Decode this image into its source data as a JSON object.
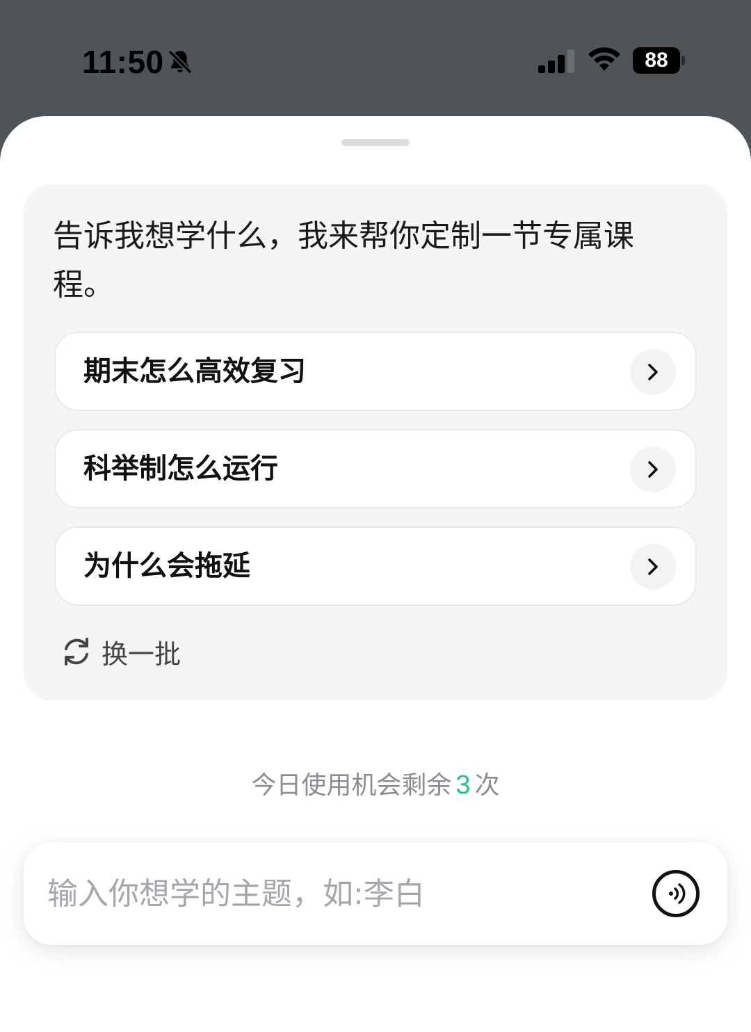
{
  "status_bar": {
    "time": "11:50",
    "battery": "88",
    "icons": [
      "bell-muted-icon",
      "cellular-signal-icon",
      "wifi-icon",
      "battery-icon"
    ]
  },
  "card": {
    "prompt": "告诉我想学什么，我来帮你定制一节专属课程。",
    "suggestions": [
      {
        "label": "期末怎么高效复习",
        "icon": "chevron-right-icon"
      },
      {
        "label": "科举制怎么运行",
        "icon": "chevron-right-icon"
      },
      {
        "label": "为什么会拖延",
        "icon": "chevron-right-icon"
      }
    ],
    "refresh": {
      "label": "换一批",
      "icon": "refresh-icon"
    }
  },
  "usage": {
    "prefix": "今日使用机会剩余",
    "count": "3",
    "suffix": "次"
  },
  "input": {
    "placeholder": "输入你想学的主题，如:李白",
    "value": "",
    "voice_icon": "voice-input-icon"
  },
  "colors": {
    "accent": "#22c28a",
    "card_bg": "#f4f5f6",
    "top_bg": "#4d5357"
  }
}
